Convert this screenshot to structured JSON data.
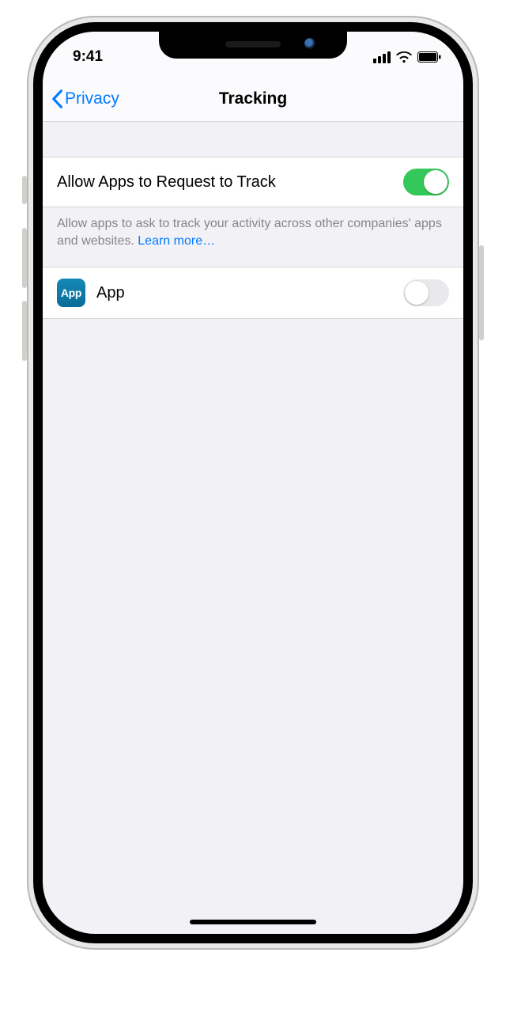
{
  "status": {
    "time": "9:41"
  },
  "nav": {
    "back_label": "Privacy",
    "title": "Tracking"
  },
  "settings": {
    "allow_request": {
      "label": "Allow Apps to Request to Track",
      "value": true,
      "footer": "Allow apps to ask to track your activity across other companies' apps and websites. ",
      "learn_more": "Learn more…"
    },
    "apps": [
      {
        "name": "App",
        "icon_text": "App",
        "value": false
      }
    ]
  }
}
